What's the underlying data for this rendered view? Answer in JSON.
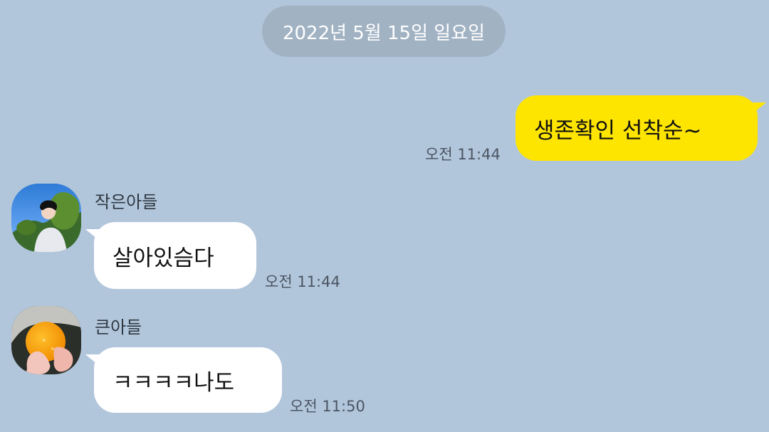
{
  "chat": {
    "date_separator": "2022년 5월 15일 일요일",
    "messages": [
      {
        "type": "sent",
        "text": "생존확인 선착순~",
        "time": "오전 11:44"
      },
      {
        "type": "received",
        "sender": "작은아들",
        "text": "살아있슴다",
        "time": "오전 11:44",
        "avatar": "profile-photo-person"
      },
      {
        "type": "received",
        "sender": "큰아들",
        "text": "ㅋㅋㅋㅋ나도",
        "time": "오전 11:50",
        "avatar": "profile-photo-orange"
      }
    ]
  },
  "colors": {
    "background": "#b2c6db",
    "date_pill": "#a1b2c3",
    "sent_bubble": "#fee500",
    "received_bubble": "#ffffff"
  }
}
